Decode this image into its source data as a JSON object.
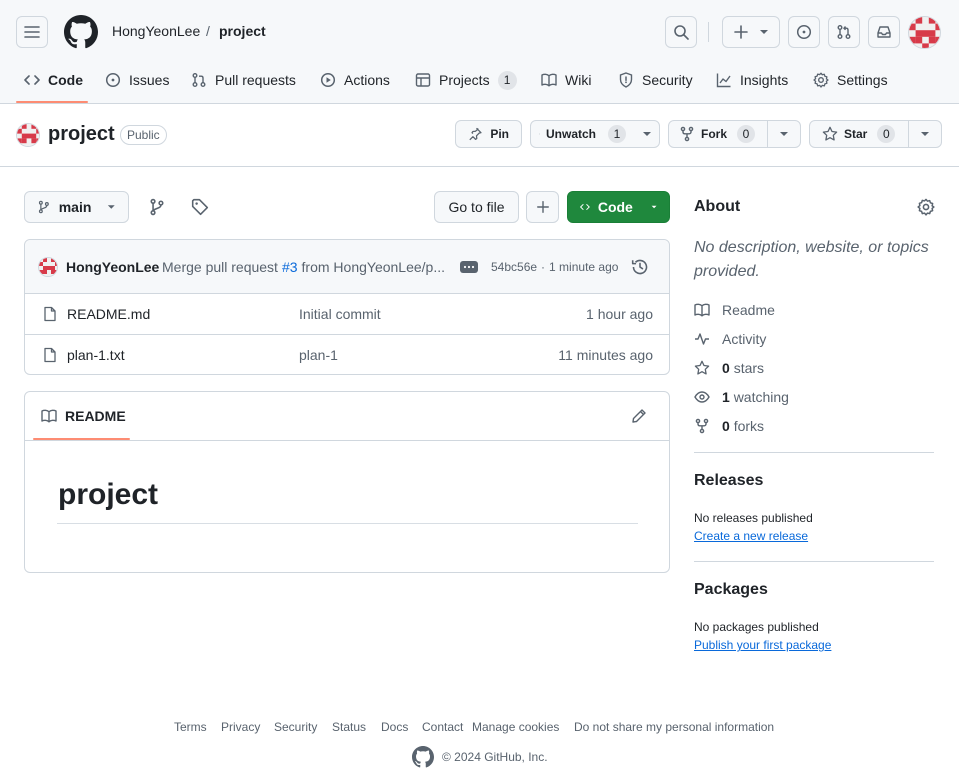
{
  "header": {
    "owner": "HongYeonLee",
    "separator": "/",
    "repo": "project"
  },
  "tabs": [
    {
      "label": "Code",
      "icon": "code-icon"
    },
    {
      "label": "Issues",
      "icon": "issue-icon"
    },
    {
      "label": "Pull requests",
      "icon": "pull-request-icon"
    },
    {
      "label": "Actions",
      "icon": "play-icon"
    },
    {
      "label": "Projects",
      "icon": "table-icon",
      "count": "1"
    },
    {
      "label": "Wiki",
      "icon": "book-icon"
    },
    {
      "label": "Security",
      "icon": "shield-icon"
    },
    {
      "label": "Insights",
      "icon": "graph-icon"
    },
    {
      "label": "Settings",
      "icon": "gear-icon"
    }
  ],
  "repo_header": {
    "name": "project",
    "visibility": "Public",
    "pin_label": "Pin",
    "watch_label": "Unwatch",
    "watch_count": "1",
    "fork_label": "Fork",
    "fork_count": "0",
    "star_label": "Star",
    "star_count": "0"
  },
  "toolbar": {
    "branch": "main",
    "go_to_file": "Go to file",
    "code_button": "Code"
  },
  "latest_commit": {
    "author": "HongYeonLee",
    "message_prefix": "Merge pull request",
    "pr_link": "#3",
    "message_suffix": "from HongYeonLee/p...",
    "sha": "54bc56e",
    "separator": "·",
    "time": "1 minute ago"
  },
  "files": [
    {
      "name": "README.md",
      "commit": "Initial commit",
      "time": "1 hour ago"
    },
    {
      "name": "plan-1.txt",
      "commit": "plan-1",
      "time": "11 minutes ago"
    }
  ],
  "readme": {
    "tab_label": "README",
    "heading": "project"
  },
  "about": {
    "title": "About",
    "description": "No description, website, or topics provided.",
    "readme_link": "Readme",
    "activity_link": "Activity",
    "stars_count": "0",
    "stars_label": "stars",
    "watching_count": "1",
    "watching_label": "watching",
    "forks_count": "0",
    "forks_label": "forks"
  },
  "releases": {
    "title": "Releases",
    "empty_text": "No releases published",
    "create_link": "Create a new release"
  },
  "packages": {
    "title": "Packages",
    "empty_text": "No packages published",
    "publish_link": "Publish your first package"
  },
  "footer": {
    "links": [
      "Terms",
      "Privacy",
      "Security",
      "Status",
      "Docs",
      "Contact",
      "Manage cookies",
      "Do not share my personal information"
    ],
    "copyright": "© 2024 GitHub, Inc."
  },
  "colors": {
    "accent_green": "#1f883d",
    "link_blue": "#0969da",
    "tab_underline": "#fd8c73",
    "avatar_red": "#d73a49"
  }
}
